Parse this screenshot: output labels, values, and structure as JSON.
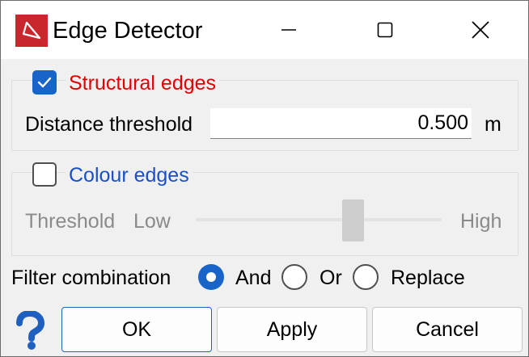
{
  "window": {
    "title": "Edge Detector",
    "icon": "app-logo-icon",
    "controls": [
      "minimize-icon",
      "maximize-icon",
      "close-icon"
    ]
  },
  "structural_edges": {
    "label": "Structural edges",
    "checked": true,
    "label_color": "#e00000",
    "distance_label": "Distance threshold",
    "distance_value": "0.500",
    "distance_unit": "m"
  },
  "colour_edges": {
    "label": "Colour edges",
    "checked": false,
    "label_color": "#1a4fc8",
    "threshold_label": "Threshold",
    "low_label": "Low",
    "high_label": "High",
    "slider_level": 0.6
  },
  "filter_combination": {
    "label": "Filter combination",
    "options": [
      "And",
      "Or",
      "Replace"
    ],
    "selected": "And"
  },
  "buttons": {
    "ok": "OK",
    "apply": "Apply",
    "cancel": "Cancel"
  },
  "colors": {
    "accent": "#1864c8",
    "title_bar": "#ffffff",
    "dialog_bg": "#f0f0f0",
    "brand_red": "#c8282d",
    "help_blue": "#1f5fbf"
  },
  "icons": {
    "help": "question-icon"
  }
}
